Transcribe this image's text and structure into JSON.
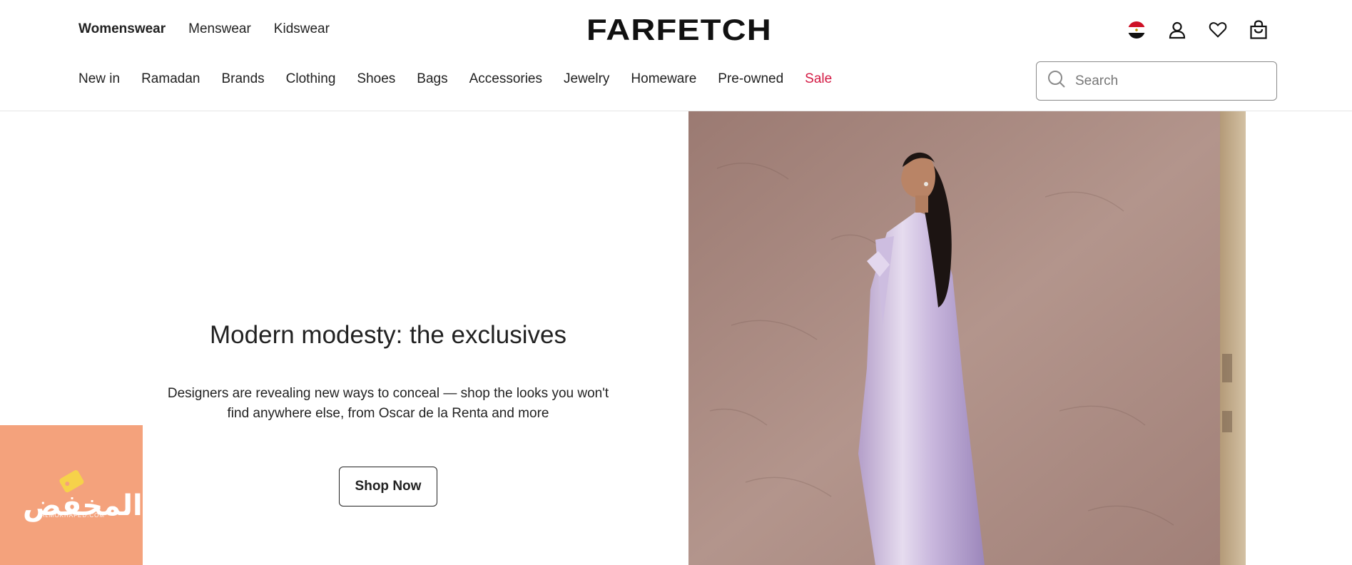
{
  "header": {
    "gender_tabs": [
      {
        "label": "Womenswear",
        "active": true
      },
      {
        "label": "Menswear",
        "active": false
      },
      {
        "label": "Kidswear",
        "active": false
      }
    ],
    "logo": "FARFETCH",
    "icons": [
      "egypt-flag-icon",
      "account-icon",
      "wishlist-heart-icon",
      "shopping-bag-icon"
    ]
  },
  "nav": {
    "items": [
      {
        "label": "New in"
      },
      {
        "label": "Ramadan"
      },
      {
        "label": "Brands"
      },
      {
        "label": "Clothing"
      },
      {
        "label": "Shoes"
      },
      {
        "label": "Bags"
      },
      {
        "label": "Accessories"
      },
      {
        "label": "Jewelry"
      },
      {
        "label": "Homeware"
      },
      {
        "label": "Pre-owned"
      },
      {
        "label": "Sale"
      }
    ],
    "sale_color": "#d41a44"
  },
  "search": {
    "placeholder": "Search",
    "value": ""
  },
  "hero": {
    "title": "Modern modesty: the exclusives",
    "description": "Designers are revealing new ways to conceal — shop the looks you won't find anywhere else, from Oscar de la Renta and more",
    "cta_label": "Shop Now"
  },
  "badge": {
    "text": "المخفض",
    "subtext": "ALMOKHAFED.COM",
    "color": "#f4a27c"
  }
}
